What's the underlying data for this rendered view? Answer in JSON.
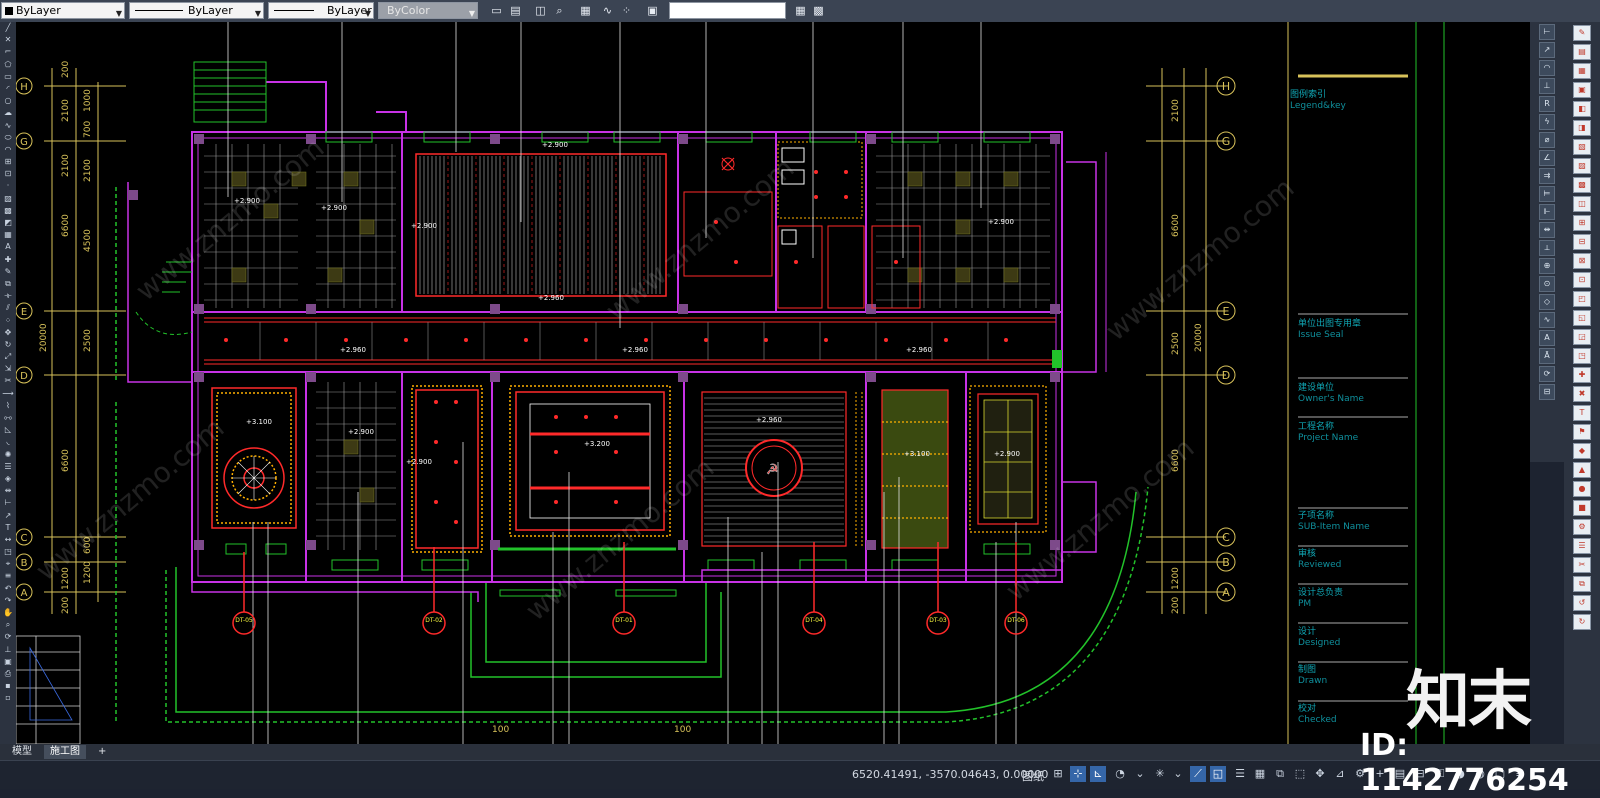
{
  "toolbar": {
    "color_select": "ByLayer",
    "linetype_select": "ByLayer",
    "lineweight_select": "ByLayer",
    "plotstyle_select": "ByColor",
    "command_input": ""
  },
  "drawing": {
    "grid_left_labels": [
      "H",
      "G",
      "E",
      "D",
      "C",
      "B",
      "A"
    ],
    "grid_right_labels": [
      "H",
      "G",
      "E",
      "D",
      "C",
      "B",
      "A"
    ],
    "left_dims_outer": [
      "200",
      "2100",
      "2100",
      "6600",
      "20000",
      "6600",
      "1200",
      "200"
    ],
    "left_dims_inner": [
      "700",
      "1000",
      "2100",
      "4500",
      "2500",
      "1200",
      "600"
    ],
    "right_dims": [
      "2100",
      "6600",
      "2500",
      "20000",
      "6600",
      "1200",
      "200"
    ],
    "elevation_tags": [
      "+2.900",
      "+2.900",
      "+2.900",
      "+2.900",
      "+2.960",
      "+2.900",
      "+2.960",
      "+2.960",
      "+2.960",
      "+3.100",
      "+3.200",
      "+2.900",
      "+2.900",
      "+2.960",
      "+2.900",
      "+3.100"
    ],
    "detail_callouts": [
      "DT-05",
      "DT-02",
      "DT-01",
      "DT-04",
      "DT-03",
      "DT-06"
    ],
    "bottom_ruler": [
      "100",
      "100"
    ]
  },
  "title_block": {
    "legend_cn": "图例索引",
    "legend_en": "Legend&key",
    "seal_cn": "单位出图专用章",
    "seal_en": "Issue Seal",
    "owner_cn": "建设单位",
    "owner_en": "Owner's Name",
    "project_cn": "工程名称",
    "project_en": "Project Name",
    "subitem_cn": "子项名称",
    "subitem_en": "SUB-Item Name",
    "review_cn": "审核",
    "review_en": "Reviewed",
    "pm_cn": "设计总负责",
    "pm_en": "PM",
    "design_cn": "设计",
    "design_en": "Designed",
    "drawn_cn": "制图",
    "drawn_en": "Drawn",
    "check_cn": "校对",
    "check_en": "Checked"
  },
  "tabs": [
    "模型",
    "施工图",
    "+"
  ],
  "status": {
    "coordinates": "6520.41491, -3570.04643, 0.00000",
    "space_label": "图纸"
  },
  "watermark": {
    "logo": "知末",
    "id": "ID: 1142776254",
    "site": "www.znzmo.com"
  },
  "colors": {
    "canvas_bg": "#000000",
    "wall_magenta": "#c832e6",
    "red_lines": "#ff2a2a",
    "grid_yellow": "#d8c25a",
    "green_lines": "#22c22a",
    "cyan_text": "#10a6b4"
  }
}
